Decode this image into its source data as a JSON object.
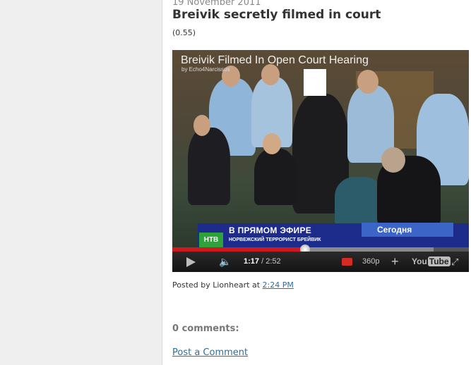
{
  "post": {
    "date": "19 November 2011",
    "title": "Breivik secretly filmed in court",
    "rating": "(0.55)"
  },
  "video": {
    "title": "Breivik Filmed In Open Court Hearing",
    "uploader": "by Echo4Narcissus",
    "banner_live": "В ПРЯМОМ ЭФИРЕ",
    "banner_sub": "НОРВЕЖСКИЙ ТЕРРОРИСТ БРЕЙВИК",
    "banner_today": "Сегодня",
    "channel_logo": "НТВ",
    "current_time": "1:17",
    "duration": "/ 2:52",
    "progress_fraction": 0.447,
    "loaded_fraction": 0.88,
    "quality": "360p",
    "brand": "You",
    "brand_tube": "Tube",
    "icons": [
      "play-icon",
      "volume-icon",
      "captions-icon",
      "plus-icon",
      "fullscreen-icon"
    ]
  },
  "footer": {
    "posted_by_prefix": "Posted by Lionheart at",
    "posted_time": "2:24 PM",
    "comments": "0 comments:",
    "post_comment": "Post a Comment"
  },
  "colors": {
    "link": "#2b6e9e",
    "progress_played": "#cc181e",
    "banner": "#1d2b8a"
  }
}
